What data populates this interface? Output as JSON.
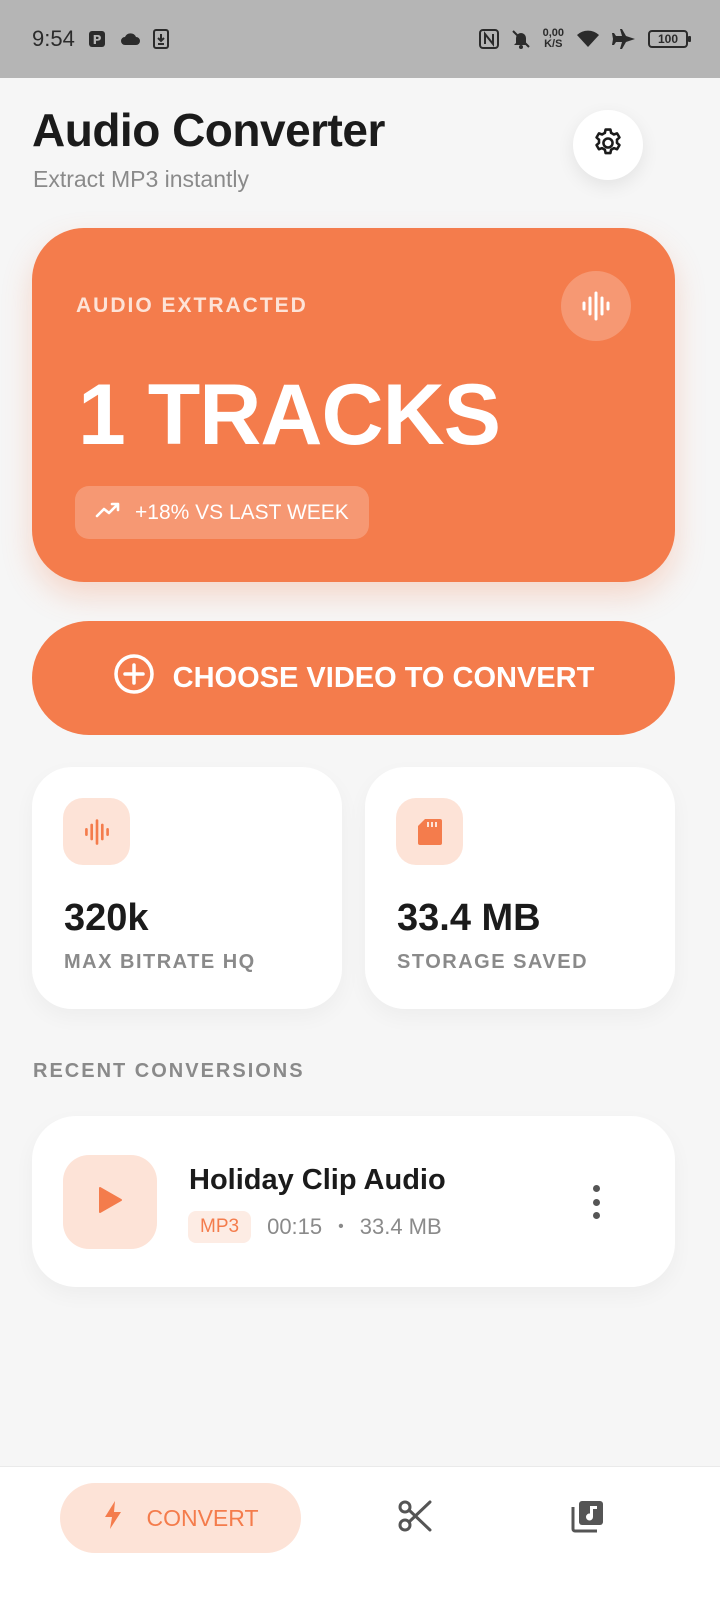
{
  "status_bar": {
    "time": "9:54",
    "net_speed_value": "0,00",
    "net_speed_unit": "K/S",
    "battery": "100",
    "icons": [
      "parking-icon",
      "cloud-icon",
      "download-icon",
      "nfc-icon",
      "bell-off-icon",
      "wifi-icon",
      "airplane-icon",
      "battery-icon"
    ]
  },
  "header": {
    "title": "Audio Converter",
    "subtitle": "Extract MP3 instantly"
  },
  "hero": {
    "label": "AUDIO EXTRACTED",
    "value": "1 TRACKS",
    "trend": "+18% VS LAST WEEK"
  },
  "actions": {
    "choose_label": "CHOOSE VIDEO TO CONVERT"
  },
  "stats": [
    {
      "value": "320k",
      "label": "MAX BITRATE HQ",
      "icon": "waveform-icon"
    },
    {
      "value": "33.4 MB",
      "label": "STORAGE SAVED",
      "icon": "sd-card-icon"
    }
  ],
  "recent": {
    "section_title": "RECENT CONVERSIONS",
    "items": [
      {
        "title": "Holiday Clip Audio",
        "format": "MP3",
        "duration": "00:15",
        "separator": "•",
        "size": "33.4 MB"
      }
    ]
  },
  "nav": {
    "convert_label": "CONVERT"
  },
  "colors": {
    "accent": "#f47c4c",
    "accent_soft": "#fde3d7",
    "background": "#f6f6f6"
  }
}
